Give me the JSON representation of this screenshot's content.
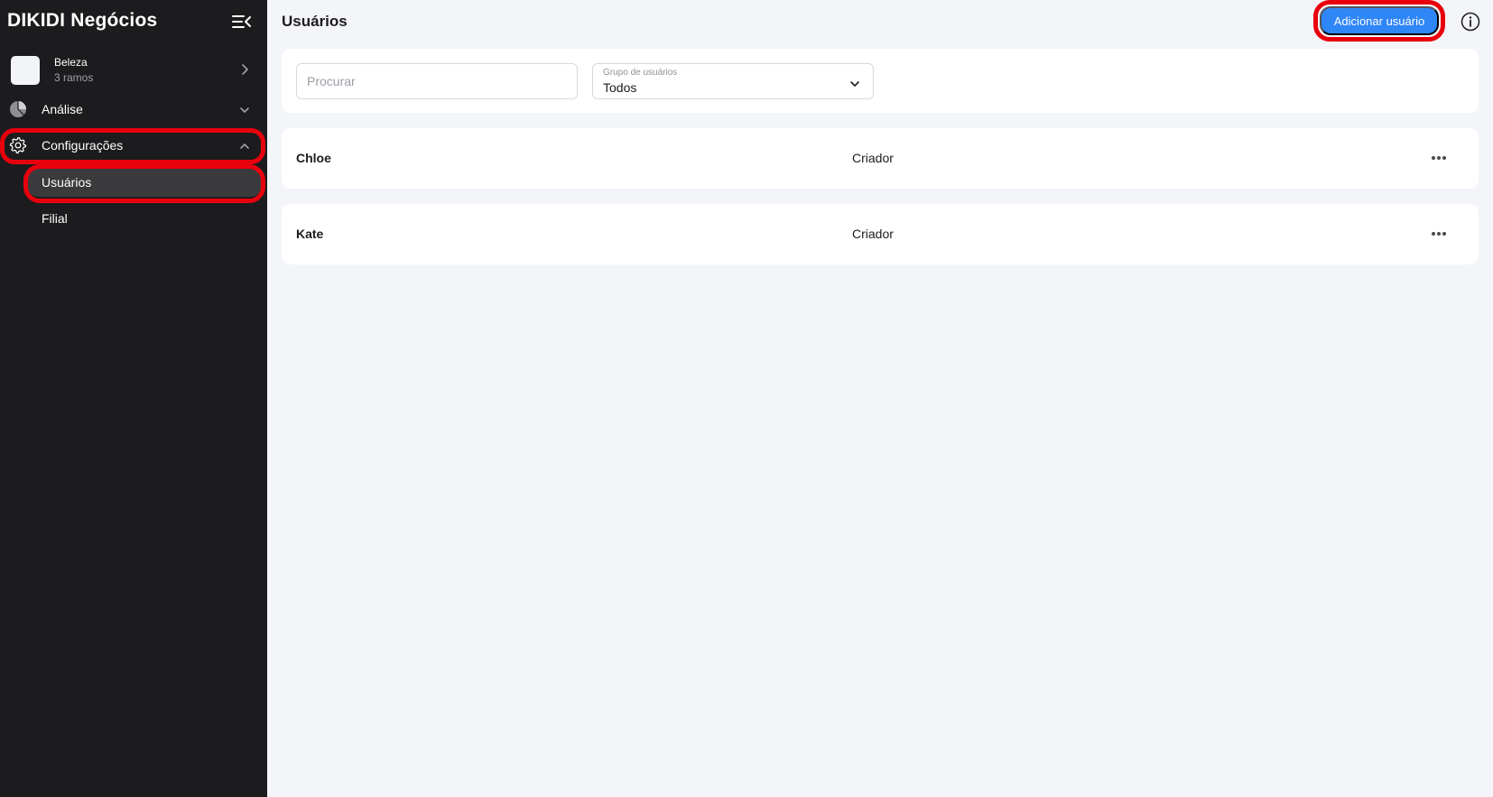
{
  "sidebar": {
    "brand": "DIKIDI Negócios",
    "account": {
      "name": "Beleza",
      "subtitle": "3 ramos"
    },
    "nav": {
      "analise": "Análise",
      "configuracoes": "Configurações",
      "sub_items": [
        "Usuários",
        "Filial"
      ]
    }
  },
  "header": {
    "title": "Usuários",
    "add_button": "Adicionar usuário"
  },
  "filters": {
    "search_placeholder": "Procurar",
    "group_label": "Grupo de usuários",
    "group_value": "Todos"
  },
  "users": [
    {
      "name": "Chloe",
      "role": "Criador"
    },
    {
      "name": "Kate",
      "role": "Criador"
    }
  ],
  "colors": {
    "sidebar_bg": "#1c1c1e",
    "accent": "#2f86f6",
    "highlight": "#e8000d",
    "page_bg": "#f3f5f9"
  },
  "icons": [
    "collapse-menu-icon",
    "chevron-right-icon",
    "pie-chart-icon",
    "chevron-down-icon",
    "gear-icon",
    "chevron-up-icon",
    "info-icon",
    "more-horizontal-icon"
  ]
}
